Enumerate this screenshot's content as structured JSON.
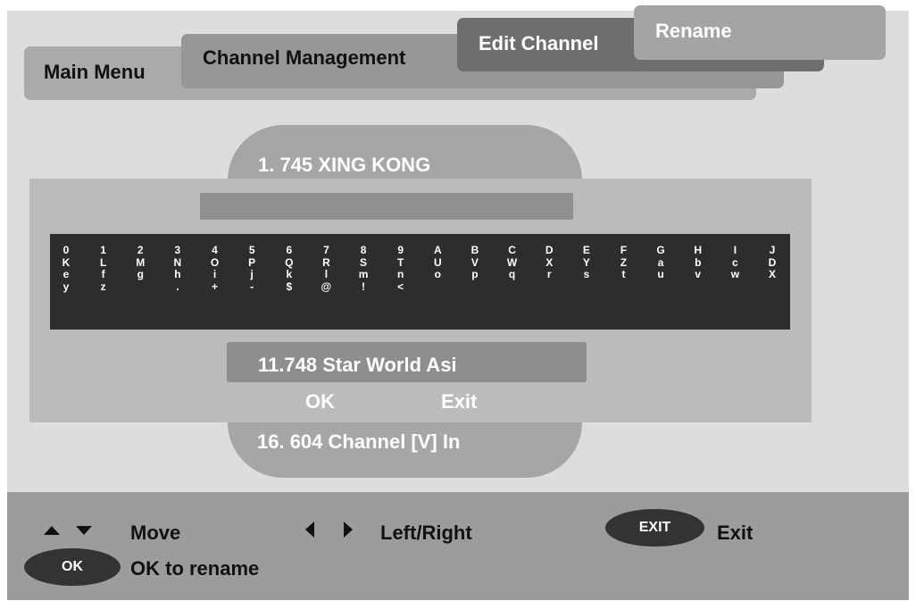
{
  "breadcrumb": {
    "main_menu": "Main Menu",
    "channel_management": "Channel Management",
    "edit_channel": "Edit Channel",
    "rename": "Rename"
  },
  "channels": {
    "previous": "1. 745 XING KONG",
    "current_name": "11.748 Star World Asi",
    "next": "16. 604 Channel [V] In"
  },
  "keyboard": {
    "columns": [
      [
        "0",
        "K",
        "e",
        "y"
      ],
      [
        "1",
        "L",
        "f",
        "z"
      ],
      [
        "2",
        "M",
        "g",
        ""
      ],
      [
        "3",
        "N",
        "h",
        "."
      ],
      [
        "4",
        "O",
        "i",
        "+"
      ],
      [
        "5",
        "P",
        "j",
        "-"
      ],
      [
        "6",
        "Q",
        "k",
        "$"
      ],
      [
        "7",
        "R",
        "l",
        "@"
      ],
      [
        "8",
        "S",
        "m",
        "!"
      ],
      [
        "9",
        "T",
        "n",
        "<"
      ],
      [
        "A",
        "U",
        "o",
        ""
      ],
      [
        "B",
        "V",
        "p",
        ""
      ],
      [
        "C",
        "W",
        "q",
        ""
      ],
      [
        "D",
        "X",
        "r",
        ""
      ],
      [
        "E",
        "Y",
        "s",
        ""
      ],
      [
        "F",
        "Z",
        "t",
        ""
      ],
      [
        "G",
        "a",
        "u",
        ""
      ],
      [
        "H",
        "b",
        "v",
        ""
      ],
      [
        "I",
        "c",
        "w",
        ""
      ],
      [
        "J",
        "D",
        "X",
        ""
      ]
    ]
  },
  "dialog": {
    "ok_label": "OK",
    "exit_label": "Exit"
  },
  "help": {
    "move": "Move",
    "left_right": "Left/Right",
    "exit_key": "EXIT",
    "exit": "Exit",
    "ok_key": "OK",
    "ok_to_rename": "OK to rename"
  },
  "colors": {
    "background": "#dddddd",
    "keyboard_bg": "#2d2d2d",
    "panel": "#bbbbbb",
    "help_bar": "#9c9c9c"
  },
  "icons": [
    "arrow-up-icon",
    "arrow-down-icon",
    "arrow-left-icon",
    "arrow-right-icon"
  ]
}
